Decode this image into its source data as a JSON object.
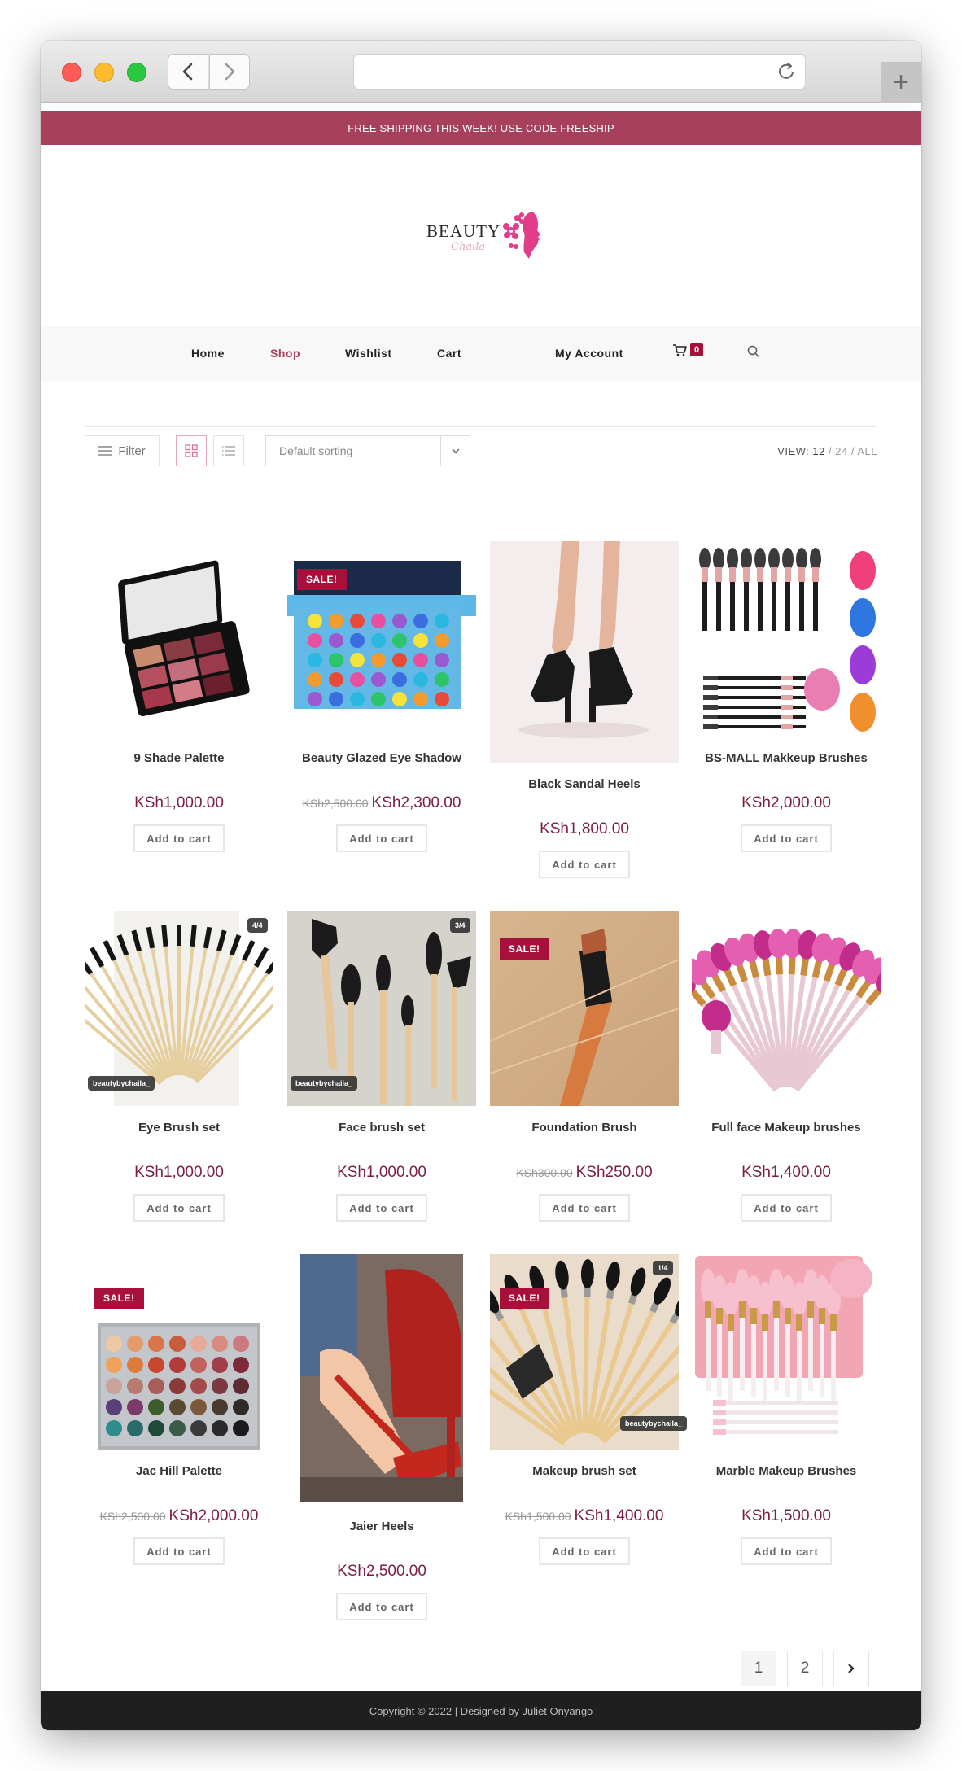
{
  "browser": {
    "back_icon": "chevron-left-icon",
    "forward_icon": "chevron-right-icon",
    "reload_icon": "reload-icon",
    "new_tab_icon": "plus-icon",
    "new_tab_glyph": "+"
  },
  "promo": {
    "text": "FREE SHIPPING THIS WEEK! USE CODE FREESHIP",
    "color": "#a6405c"
  },
  "logo": {
    "brand": "BEAUTY",
    "script": "Chaila"
  },
  "nav": {
    "items": [
      "Home",
      "Shop",
      "Wishlist",
      "Cart",
      "My Account"
    ],
    "active": "Shop",
    "cart_count": "0"
  },
  "toolbar": {
    "filter_label": "Filter",
    "sort_value": "Default sorting",
    "view_label": "VIEW:",
    "view_opts": [
      "12",
      "24",
      "ALL"
    ],
    "view_selected": "12"
  },
  "products": [
    {
      "title": "9 Shade Palette",
      "price": "KSh1,000.00",
      "old_price": "",
      "sale": false,
      "button": "Add to cart"
    },
    {
      "title": "Beauty Glazed Eye Shadow",
      "price": "KSh2,300.00",
      "old_price": "KSh2,500.00",
      "sale": true,
      "sale_label": "SALE!",
      "button": "Add to cart"
    },
    {
      "title": "Black Sandal Heels",
      "price": "KSh1,800.00",
      "old_price": "",
      "sale": false,
      "button": "Add to cart"
    },
    {
      "title": "BS-MALL Makkeup Brushes",
      "price": "KSh2,000.00",
      "old_price": "",
      "sale": false,
      "button": "Add to cart"
    },
    {
      "title": "Eye Brush set",
      "price": "KSh1,000.00",
      "old_price": "",
      "sale": false,
      "button": "Add to cart",
      "img_tag": "beautybychaila_",
      "img_count": "4/4"
    },
    {
      "title": "Face brush set",
      "price": "KSh1,000.00",
      "old_price": "",
      "sale": false,
      "button": "Add to cart",
      "img_tag": "beautybychaila_",
      "img_count": "3/4"
    },
    {
      "title": "Foundation Brush",
      "price": "KSh250.00",
      "old_price": "KSh300.00",
      "sale": true,
      "sale_label": "SALE!",
      "button": "Add to cart"
    },
    {
      "title": "Full face Makeup brushes",
      "price": "KSh1,400.00",
      "old_price": "",
      "sale": false,
      "button": "Add to cart"
    },
    {
      "title": "Jac Hill Palette",
      "price": "KSh2,000.00",
      "old_price": "KSh2,500.00",
      "sale": true,
      "sale_label": "SALE!",
      "button": "Add to cart"
    },
    {
      "title": "Jaier Heels",
      "price": "KSh2,500.00",
      "old_price": "",
      "sale": false,
      "button": "Add to cart"
    },
    {
      "title": "Makeup brush set",
      "price": "KSh1,400.00",
      "old_price": "KSh1,500.00",
      "sale": true,
      "sale_label": "SALE!",
      "button": "Add to cart",
      "img_tag": "beautybychaila_",
      "img_count": "1/4"
    },
    {
      "title": "Marble Makeup Brushes",
      "price": "KSh1,500.00",
      "old_price": "",
      "sale": false,
      "button": "Add to cart"
    }
  ],
  "pagination": {
    "pages": [
      "1",
      "2"
    ],
    "current": "1",
    "next_icon": "chevron-right-icon"
  },
  "footer": {
    "text": "Copyright © 2022 | Designed by Juliet Onyango"
  },
  "colors": {
    "accent": "#a6405c",
    "price": "#7b1d44",
    "sale_badge": "#a6103a"
  }
}
